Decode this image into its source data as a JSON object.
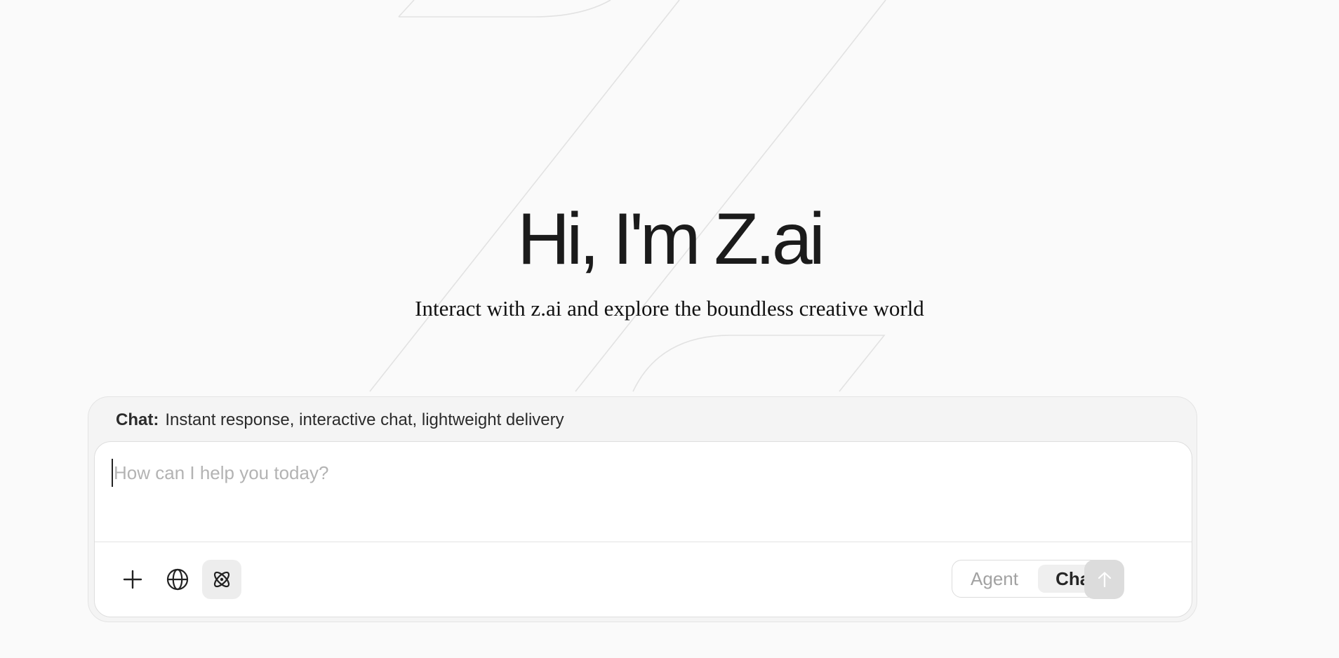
{
  "hero": {
    "title": "Hi, I'm Z.ai",
    "subtitle": "Interact with z.ai and explore the boundless creative world"
  },
  "composer": {
    "mode_note": {
      "mode_name": "Chat:",
      "description": "Instant response, interactive chat, lightweight delivery"
    },
    "input": {
      "placeholder": "How can I help you today?",
      "value": ""
    },
    "tools": [
      {
        "icon": "plus-icon",
        "active": false
      },
      {
        "icon": "globe-icon",
        "active": false
      },
      {
        "icon": "atom-icon",
        "active": true
      }
    ],
    "mode_toggle": {
      "options": [
        "Agent",
        "Chat"
      ],
      "selected": "Chat"
    },
    "send": {
      "icon": "arrow-up-icon",
      "enabled": false
    }
  },
  "colors": {
    "background": "#fafafa",
    "composer_outer": "#f4f4f4",
    "composer_inner": "#ffffff",
    "send_disabled": "#dcdcdc"
  }
}
